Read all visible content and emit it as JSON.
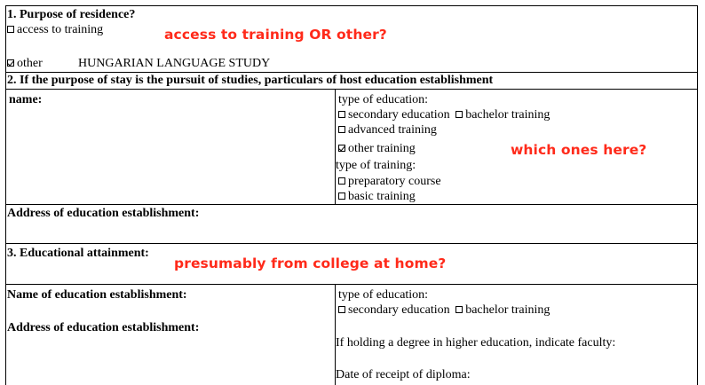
{
  "section1": {
    "title": "1. Purpose of residence?",
    "opt_access": "access to training",
    "opt_other": "other",
    "other_value": "HUNGARIAN LANGUAGE STUDY",
    "annotation": "access to training  OR other?"
  },
  "section2": {
    "title": "2. If the purpose of stay is the pursuit of studies, particulars of host education establishment",
    "name_label": "name:",
    "type_education_label": "type of education:",
    "opt_secondary": "secondary education",
    "opt_bachelor": "bachelor training",
    "opt_advanced": "advanced training",
    "opt_other_training": "other training",
    "type_training_label": "type of training:",
    "opt_preparatory": "preparatory course",
    "opt_basic": "basic training",
    "annotation": "which ones here?",
    "address_label": "Address of education establishment:"
  },
  "section3": {
    "title": "3. Educational attainment:",
    "annotation": "presumably from college at home?",
    "name_label": "Name of education establishment:",
    "address_label": "Address of education establishment:",
    "type_education_label": "type of education:",
    "opt_secondary": "secondary education",
    "opt_bachelor": "bachelor training",
    "degree_label": "If holding a degree in higher education, indicate faculty:",
    "diploma_label": "Date of receipt of diploma:"
  }
}
